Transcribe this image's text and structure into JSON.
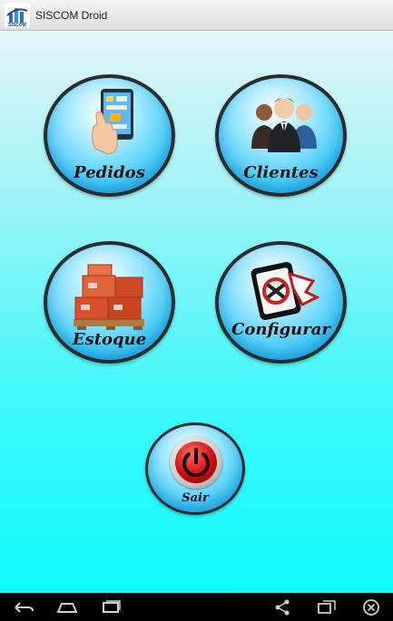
{
  "app": {
    "title": "SISCOM Droid",
    "icon_text": "SISCOM",
    "icon": "siscom-logo-icon"
  },
  "menu": {
    "pedidos": {
      "label": "Pedidos",
      "icon": "tablet-touch-icon"
    },
    "clientes": {
      "label": "Clientes",
      "icon": "people-group-icon"
    },
    "estoque": {
      "label": "Estoque",
      "icon": "boxes-pallet-icon"
    },
    "configurar": {
      "label": "Configurar",
      "icon": "settings-tool-icon"
    },
    "sair": {
      "label": "Sair",
      "icon": "power-icon"
    }
  },
  "navbar": {
    "icons": [
      "back-icon",
      "home-icon",
      "recent-apps-icon",
      "share-icon",
      "screen-rotate-icon",
      "close-icon"
    ]
  },
  "colors": {
    "background_top": "#e3f5f8",
    "background_bottom": "#0ffcfe",
    "button_fill": "#3cc8f6",
    "button_border": "#2a2d2f",
    "power_red": "#d20e0e"
  }
}
